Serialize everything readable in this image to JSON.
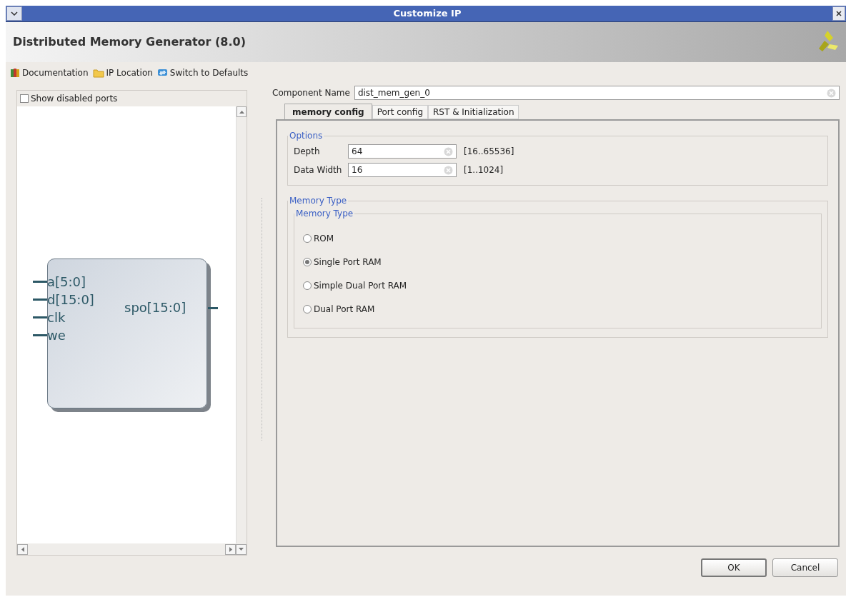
{
  "window": {
    "title": "Customize IP"
  },
  "header": {
    "title": "Distributed Memory Generator (8.0)"
  },
  "toolbar": [
    {
      "kind": "book",
      "label": "Documentation"
    },
    {
      "kind": "folder",
      "label": "IP Location"
    },
    {
      "kind": "refresh",
      "label": "Switch to Defaults"
    }
  ],
  "symbol_panel": {
    "show_disabled_ports": {
      "label": "Show disabled ports",
      "checked": false
    },
    "inputs": [
      "a[5:0]",
      "d[15:0]",
      "clk",
      "we"
    ],
    "outputs": [
      "spo[15:0]"
    ]
  },
  "component_name": {
    "label": "Component Name",
    "value": "dist_mem_gen_0"
  },
  "tabs": [
    {
      "label": "memory config",
      "selected": true
    },
    {
      "label": "Port config",
      "selected": false
    },
    {
      "label": "RST & Initialization",
      "selected": false
    }
  ],
  "options": {
    "title": "Options",
    "fields": [
      {
        "label": "Depth",
        "value": "64",
        "range": "[16..65536]"
      },
      {
        "label": "Data Width",
        "value": "16",
        "range": "[1..1024]"
      }
    ]
  },
  "memory_type": {
    "title": "Memory Type",
    "inner_title": "Memory Type",
    "choices": [
      {
        "label": "ROM",
        "selected": false
      },
      {
        "label": "Single Port RAM",
        "selected": true
      },
      {
        "label": "Simple Dual Port RAM",
        "selected": false
      },
      {
        "label": "Dual Port RAM",
        "selected": false
      }
    ]
  },
  "buttons": [
    "OK",
    "Cancel"
  ]
}
